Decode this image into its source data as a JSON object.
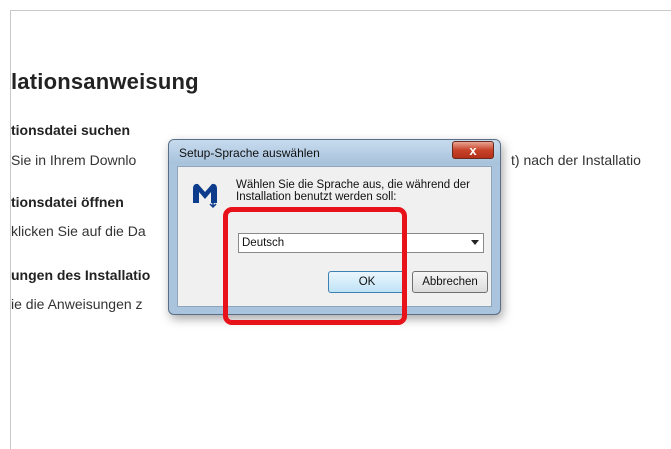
{
  "page": {
    "title": "lationsanweisung",
    "steps": [
      {
        "title": "tionsdatei suchen",
        "text": "Sie in Ihrem Downlo"
      },
      {
        "title": "tionsdatei öffnen",
        "text": "klicken Sie auf die Da"
      },
      {
        "title": "ungen des Installatio",
        "text": "ie die Anweisungen z"
      }
    ],
    "text_right_fragment": "t) nach der Installatio"
  },
  "dialog": {
    "title": "Setup-Sprache auswählen",
    "close_label": "x",
    "message": "Wählen Sie die Sprache aus, die während der Installation benutzt werden soll:",
    "language_selected": "Deutsch",
    "ok_label": "OK",
    "cancel_label": "Abbrechen",
    "logo_icon": "malwarebytes-logo-icon"
  },
  "colors": {
    "highlight": "#e8121b",
    "logo": "#0d3c8c",
    "close_button": "#c8432a"
  }
}
